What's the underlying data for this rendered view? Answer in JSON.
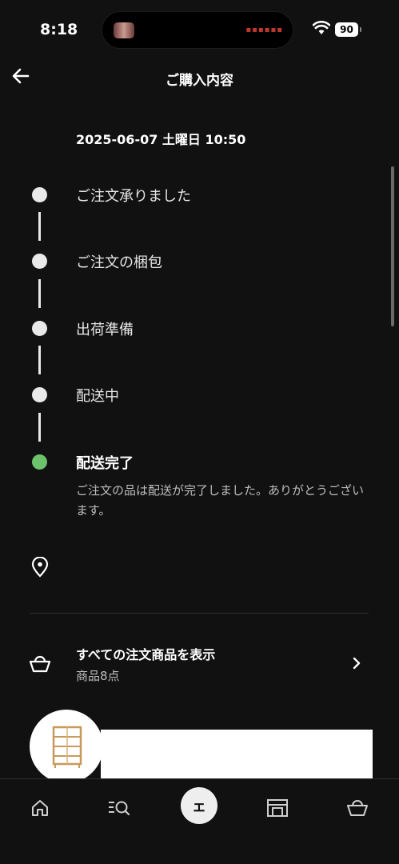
{
  "status_bar": {
    "time": "8:18",
    "battery": "90"
  },
  "header": {
    "title": "ご購入内容"
  },
  "order": {
    "date": "2025-06-07 土曜日 10:50"
  },
  "timeline": [
    {
      "label": "ご注文承りました",
      "state": "completed"
    },
    {
      "label": "ご注文の梱包",
      "state": "completed"
    },
    {
      "label": "出荷準備",
      "state": "completed"
    },
    {
      "label": "配送中",
      "state": "completed"
    },
    {
      "label": "配送完了",
      "state": "current"
    }
  ],
  "delivery_message": "ご注文の品は配送が完了しました。ありがとうございます。",
  "all_items": {
    "label": "すべての注文商品を表示",
    "count": "商品8点"
  },
  "bottom_nav": {
    "center_label": "ェ"
  },
  "colors": {
    "background": "#111111",
    "done": "#6cc36b",
    "dot": "#e9e9e9"
  }
}
